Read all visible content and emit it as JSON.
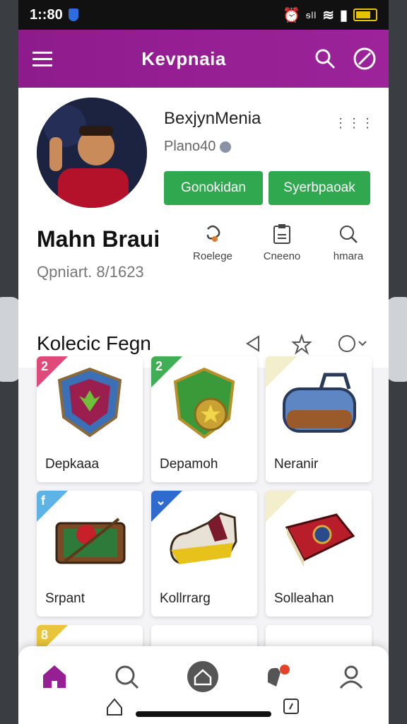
{
  "status": {
    "time": "1::80",
    "carrier": "ᵴll"
  },
  "appbar": {
    "title": "Kevpnaia",
    "menu_icon": "menu-icon",
    "search_icon": "search-icon",
    "compass_icon": "compass-icon"
  },
  "profile": {
    "username": "BexjynMenia",
    "subtitle": "Plano40",
    "button1": "Gonokidan",
    "button2": "Syerbpaoak",
    "name": "Mahn Braui",
    "meta": "Qpniart.  8/1623",
    "stats": [
      {
        "label": "Roelege",
        "icon": "swirl-icon"
      },
      {
        "label": "Cneeno",
        "icon": "clipboard-icon"
      },
      {
        "label": "hmara",
        "icon": "magnifier-icon"
      }
    ]
  },
  "collection": {
    "title": "Kolecic Fegn",
    "items": [
      {
        "label": "Depkaaa",
        "badge": "2",
        "badge_color": "#e04a7a",
        "art": "shield-emblem"
      },
      {
        "label": "Depamoh",
        "badge": "2",
        "badge_color": "#3fae55",
        "art": "green-star-emblem"
      },
      {
        "label": "Neranir",
        "badge": "",
        "badge_color": "#f3eecb",
        "art": "blue-bag"
      },
      {
        "label": "Srpant",
        "badge": "f",
        "badge_color": "#5db3e6",
        "art": "pool-table"
      },
      {
        "label": "Kollrrarg",
        "badge": "⌄",
        "badge_color": "#2f6bcf",
        "art": "sneaker"
      },
      {
        "label": "Solleahan",
        "badge": "",
        "badge_color": "#f3eecb",
        "art": "red-book"
      }
    ],
    "peek_badge": "8"
  },
  "colors": {
    "brand": "#961f93",
    "green": "#2fa84f"
  }
}
